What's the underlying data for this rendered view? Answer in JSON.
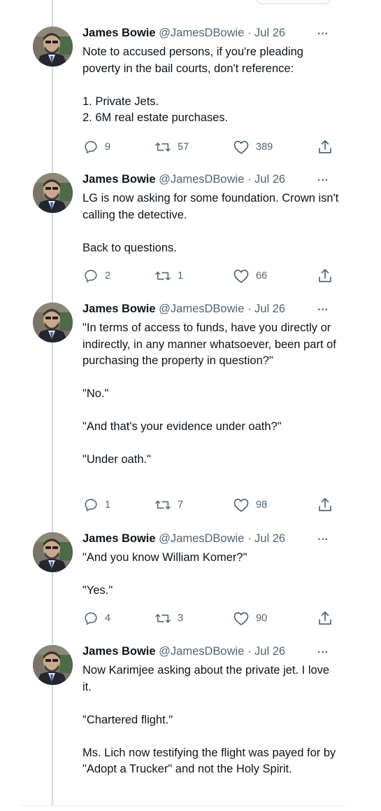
{
  "tweets": [
    {
      "name": "James Bowie",
      "handle": "@JamesDBowie",
      "separator": "·",
      "date": "Jul 26",
      "paragraphs": [
        "Note to accused persons, if you're pleading poverty in the bail courts, don't reference:",
        "1.  Private Jets.\n2.  6M real estate purchases."
      ],
      "replies": "9",
      "retweets": "57",
      "likes": "389"
    },
    {
      "name": "James Bowie",
      "handle": "@JamesDBowie",
      "separator": "·",
      "date": "Jul 26",
      "paragraphs": [
        "LG is now asking for some foundation.  Crown isn't calling the detective.",
        "Back to questions."
      ],
      "replies": "2",
      "retweets": "1",
      "likes": "66"
    },
    {
      "name": "James Bowie",
      "handle": "@JamesDBowie",
      "separator": "·",
      "date": "Jul 26",
      "paragraphs": [
        "\"In terms of access to funds, have you directly or indirectly, in any manner whatsoever, been part of purchasing the property in question?\"",
        "\"No.\"",
        "\"And that's your evidence under oath?\"",
        "\"Under oath.\""
      ],
      "replies": "1",
      "retweets": "7",
      "likes": "98"
    },
    {
      "name": "James Bowie",
      "handle": "@JamesDBowie",
      "separator": "·",
      "date": "Jul 26",
      "paragraphs": [
        "\"And you know William Komer?\"",
        "\"Yes.\""
      ],
      "replies": "4",
      "retweets": "3",
      "likes": "90"
    },
    {
      "name": "James Bowie",
      "handle": "@JamesDBowie",
      "separator": "·",
      "date": "Jul 26",
      "paragraphs": [
        "Now Karimjee asking about the private jet.  I love it.",
        "\"Chartered flight.\"",
        "Ms. Lich now testifying the flight was payed for by \"Adopt a Trucker\" and not the Holy Spirit."
      ]
    }
  ],
  "icons": {
    "more": "more-icon",
    "reply": "reply-icon",
    "retweet": "retweet-icon",
    "like": "like-icon",
    "share": "share-icon"
  },
  "colors": {
    "text": "#0f1419",
    "muted": "#536471",
    "thread": "#cfd9de"
  }
}
